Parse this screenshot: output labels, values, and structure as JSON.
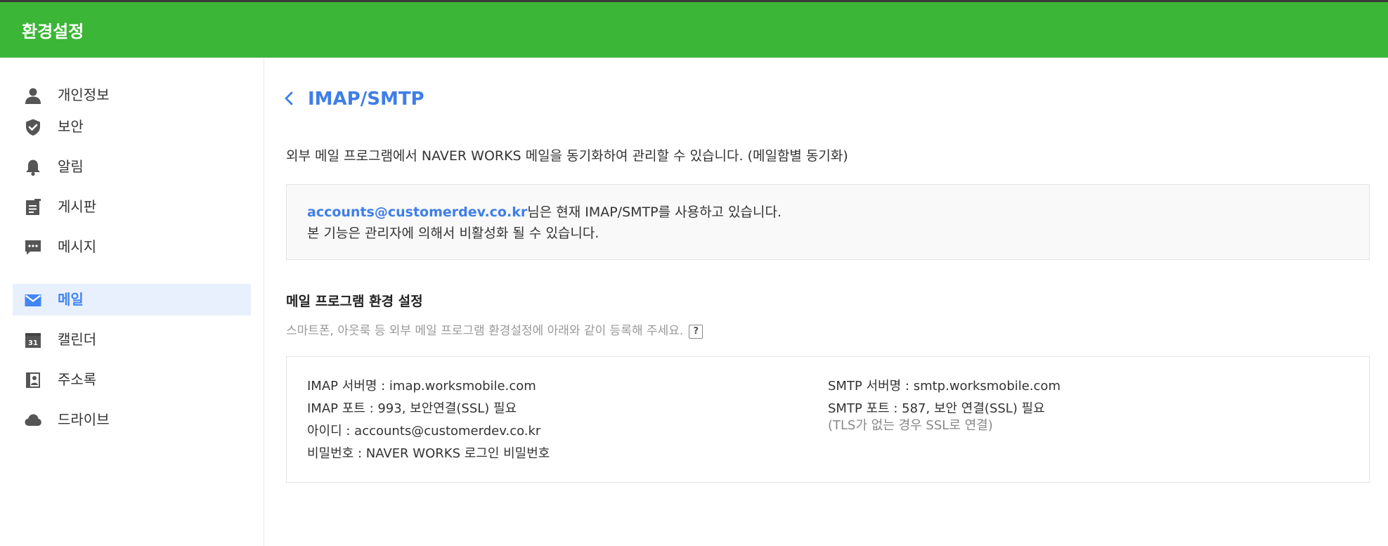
{
  "header": {
    "title": "환경설정"
  },
  "sidebar": {
    "items": [
      {
        "label": "개인정보",
        "icon": "person-icon"
      },
      {
        "label": "보안",
        "icon": "shield-icon"
      },
      {
        "label": "알림",
        "icon": "bell-icon"
      },
      {
        "label": "게시판",
        "icon": "board-icon"
      },
      {
        "label": "메시지",
        "icon": "chat-icon"
      },
      {
        "label": "메일",
        "icon": "mail-icon",
        "active": true
      },
      {
        "label": "캘린더",
        "icon": "calendar-icon",
        "icon_text": "31"
      },
      {
        "label": "주소록",
        "icon": "contacts-icon"
      },
      {
        "label": "드라이브",
        "icon": "cloud-icon"
      }
    ]
  },
  "main": {
    "title": "IMAP/SMTP",
    "description": "외부 메일 프로그램에서 NAVER WORKS 메일을 동기화하여 관리할 수 있습니다. (메일함별 동기화)",
    "notice": {
      "email": "accounts@customerdev.co.kr",
      "line1_suffix": "님은 현재 IMAP/SMTP를 사용하고 있습니다.",
      "line2": "본 기능은 관리자에 의해서 비활성화 될 수 있습니다."
    },
    "section": {
      "title": "메일 프로그램 환경 설정",
      "subtitle": "스마트폰, 아웃룩 등 외부 메일 프로그램 환경설정에 아래와 같이 등록해 주세요.",
      "help": "?"
    },
    "settings": {
      "imap_server": "IMAP 서버명 : imap.worksmobile.com",
      "imap_port": "IMAP 포트 : 993, 보안연결(SSL) 필요",
      "user_id": "아이디 : accounts@customerdev.co.kr",
      "password": "비밀번호 : NAVER WORKS 로그인 비밀번호",
      "smtp_server": "SMTP 서버명 : smtp.worksmobile.com",
      "smtp_port": "SMTP 포트 : 587, 보안 연결(SSL) 필요",
      "smtp_note": "(TLS가 없는 경우 SSL로 연결)"
    }
  },
  "colors": {
    "brand_green": "#3bb636",
    "accent_blue": "#3f7ee8",
    "active_bg": "#e9f0fd",
    "icon_gray": "#555555"
  }
}
